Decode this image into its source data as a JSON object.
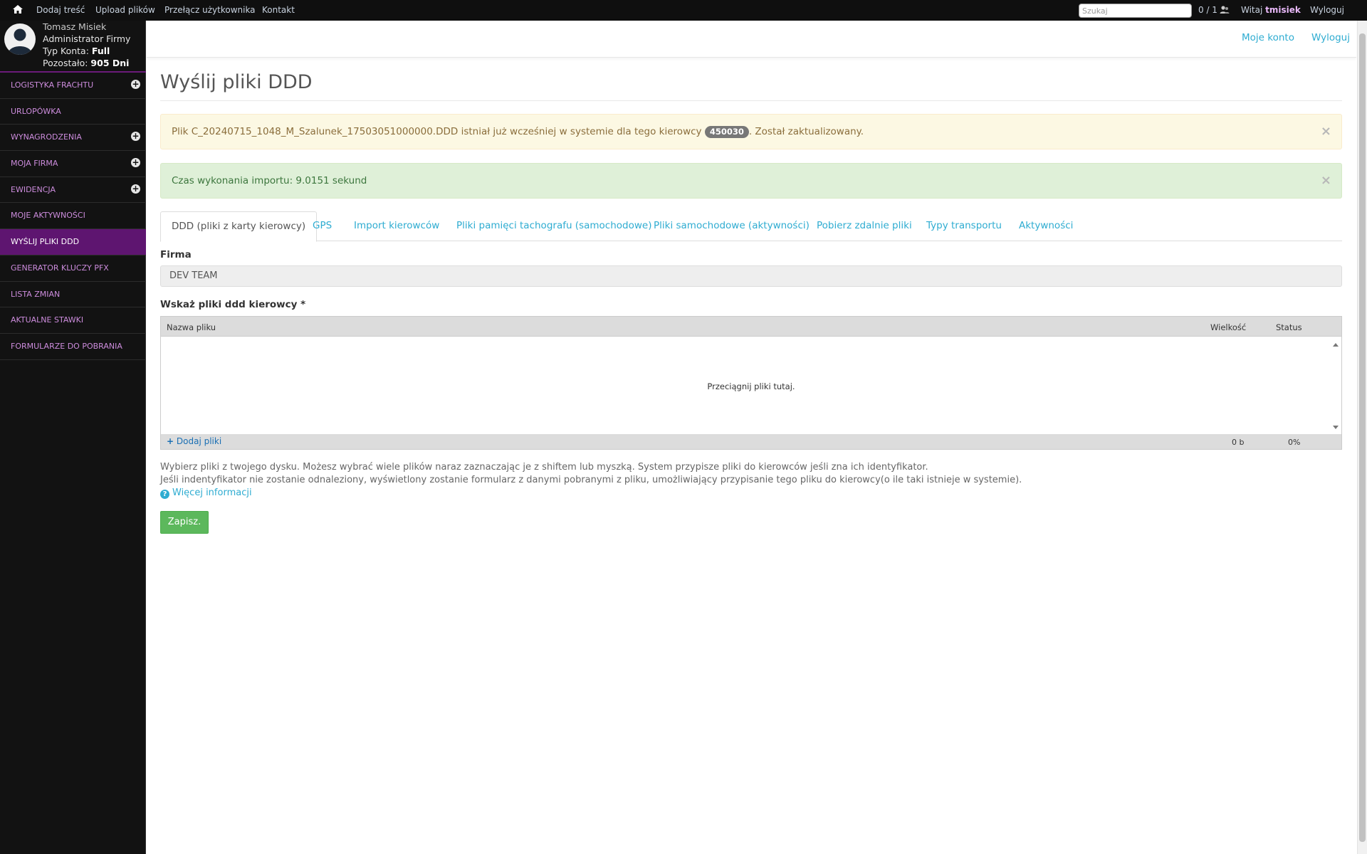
{
  "topbar": {
    "home_icon": "home-icon",
    "links": [
      "Dodaj treść",
      "Upload plików",
      "Przełącz użytkownika",
      "Kontakt"
    ],
    "search_placeholder": "Szukaj",
    "counter": "0 / 1",
    "users_icon": "users-icon",
    "welcome": "Witaj",
    "username": "tmisiek",
    "logout": "Wyloguj"
  },
  "profile": {
    "name": "Tomasz Misiek",
    "role": "Administrator Firmy",
    "account_type_label": "Typ Konta:",
    "account_type": "Full",
    "remaining_label": "Pozostało:",
    "remaining": "905 Dni"
  },
  "sidebar": {
    "items": [
      {
        "label": "LOGISTYKA FRACHTU",
        "expandable": true
      },
      {
        "label": "URLOPÓWKA",
        "expandable": false
      },
      {
        "label": "WYNAGRODZENIA",
        "expandable": true
      },
      {
        "label": "MOJA FIRMA",
        "expandable": true
      },
      {
        "label": "EWIDENCJA",
        "expandable": true
      },
      {
        "label": "MOJE AKTYWNOŚCI",
        "expandable": false
      },
      {
        "label": "WYŚLIJ PLIKI DDD",
        "expandable": false,
        "active": true
      },
      {
        "label": "GENERATOR KLUCZY PFX",
        "expandable": false
      },
      {
        "label": "LISTA ZMIAN",
        "expandable": false
      },
      {
        "label": "AKTUALNE STAWKI",
        "expandable": false
      },
      {
        "label": "FORMULARZE DO POBRANIA",
        "expandable": false
      }
    ]
  },
  "header": {
    "my_account": "Moje konto",
    "logout": "Wyloguj"
  },
  "page": {
    "title": "Wyślij pliki DDD"
  },
  "alerts": {
    "warning_before": "Plik C_20240715_1048_M_Szalunek_17503051000000.DDD istniał już wcześniej w systemie dla tego kierowcy",
    "warning_badge": "450030",
    "warning_after": ". Został zaktualizowany.",
    "success": "Czas wykonania importu: 9.0151 sekund",
    "close_symbol": "×"
  },
  "tabs": [
    "DDD (pliki z karty kierowcy)",
    "GPS",
    "Import kierowców",
    "Pliki pamięci tachografu (samochodowe)",
    "Pliki samochodowe (aktywności)",
    "Pobierz zdalnie pliki",
    "Typy transportu",
    "Aktywności"
  ],
  "form": {
    "company_label": "Firma",
    "company_value": "DEV TEAM",
    "files_label": "Wskaż pliki ddd kierowcy *"
  },
  "uploader": {
    "col_name": "Nazwa pliku",
    "col_size": "Wielkość",
    "col_status": "Status",
    "drop_hint": "Przeciągnij pliki tutaj.",
    "add_files": "Dodaj pliki",
    "total_size": "0 b",
    "total_status": "0%"
  },
  "help": {
    "line1": "Wybierz pliki z twojego dysku. Możesz wybrać wiele plików naraz zaznaczając je z shiftem lub myszką. System przypisze pliki do kierowców jeśli zna ich identyfikator.",
    "line2": "Jeśli indentyfikator nie zostanie odnaleziony, wyświetlony zostanie formularz z danymi pobranymi z pliku, umożliwiający przypisanie tego pliku do kierowcy(o ile taki istnieje w systemie).",
    "more": "Więcej informacji"
  },
  "actions": {
    "save": "Zapisz."
  }
}
